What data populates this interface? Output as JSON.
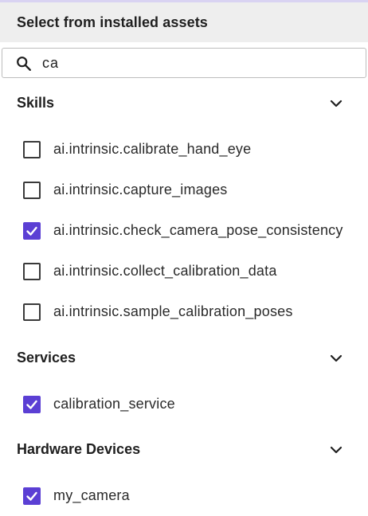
{
  "header": {
    "title": "Select from installed assets"
  },
  "search": {
    "value": "ca",
    "icon": "search-icon"
  },
  "colors": {
    "accent": "#5b3fd4",
    "header_bg": "#eeeeee",
    "top_line": "#d9d3f2"
  },
  "sections": [
    {
      "title": "Skills",
      "icon": "chevron-down-icon",
      "items": [
        {
          "label": "ai.intrinsic.calibrate_hand_eye",
          "checked": false
        },
        {
          "label": "ai.intrinsic.capture_images",
          "checked": false
        },
        {
          "label": "ai.intrinsic.check_camera_pose_consistency",
          "checked": true
        },
        {
          "label": "ai.intrinsic.collect_calibration_data",
          "checked": false
        },
        {
          "label": "ai.intrinsic.sample_calibration_poses",
          "checked": false
        }
      ]
    },
    {
      "title": "Services",
      "icon": "chevron-down-icon",
      "items": [
        {
          "label": "calibration_service",
          "checked": true
        }
      ]
    },
    {
      "title": "Hardware Devices",
      "icon": "chevron-down-icon",
      "items": [
        {
          "label": "my_camera",
          "checked": true
        }
      ]
    }
  ]
}
